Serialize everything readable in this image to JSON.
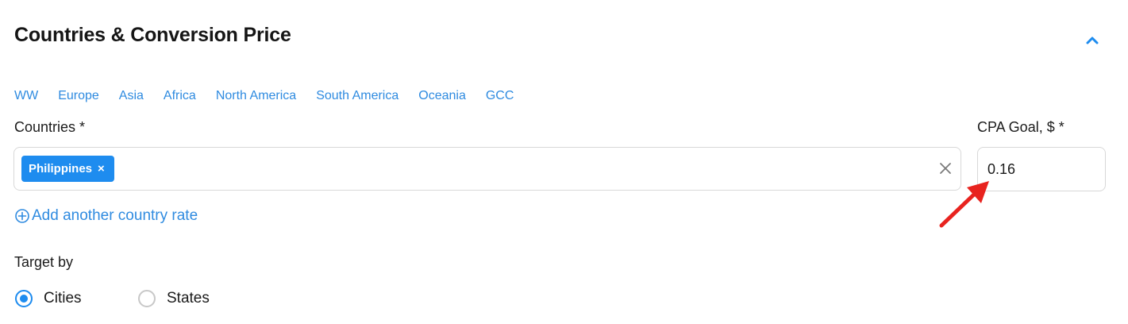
{
  "section": {
    "title": "Countries & Conversion Price"
  },
  "regions": [
    "WW",
    "Europe",
    "Asia",
    "Africa",
    "North America",
    "South America",
    "Oceania",
    "GCC"
  ],
  "countries": {
    "label": "Countries *",
    "selected": [
      {
        "name": "Philippines",
        "remove_glyph": "×"
      }
    ]
  },
  "cpa": {
    "label": "CPA Goal, $ *",
    "value": "0.16"
  },
  "add_rate": {
    "label": "Add another country rate"
  },
  "target_by": {
    "label": "Target by",
    "options": [
      {
        "label": "Cities",
        "checked": true
      },
      {
        "label": "States",
        "checked": false
      }
    ]
  },
  "colors": {
    "accent": "#1e8cef",
    "link": "#2f8be0",
    "annotation_arrow": "#e8231f",
    "border": "#d8d8d8"
  },
  "icons": {
    "collapse": "chevron-up-icon",
    "clear": "close-icon",
    "add": "plus-circle-icon"
  }
}
